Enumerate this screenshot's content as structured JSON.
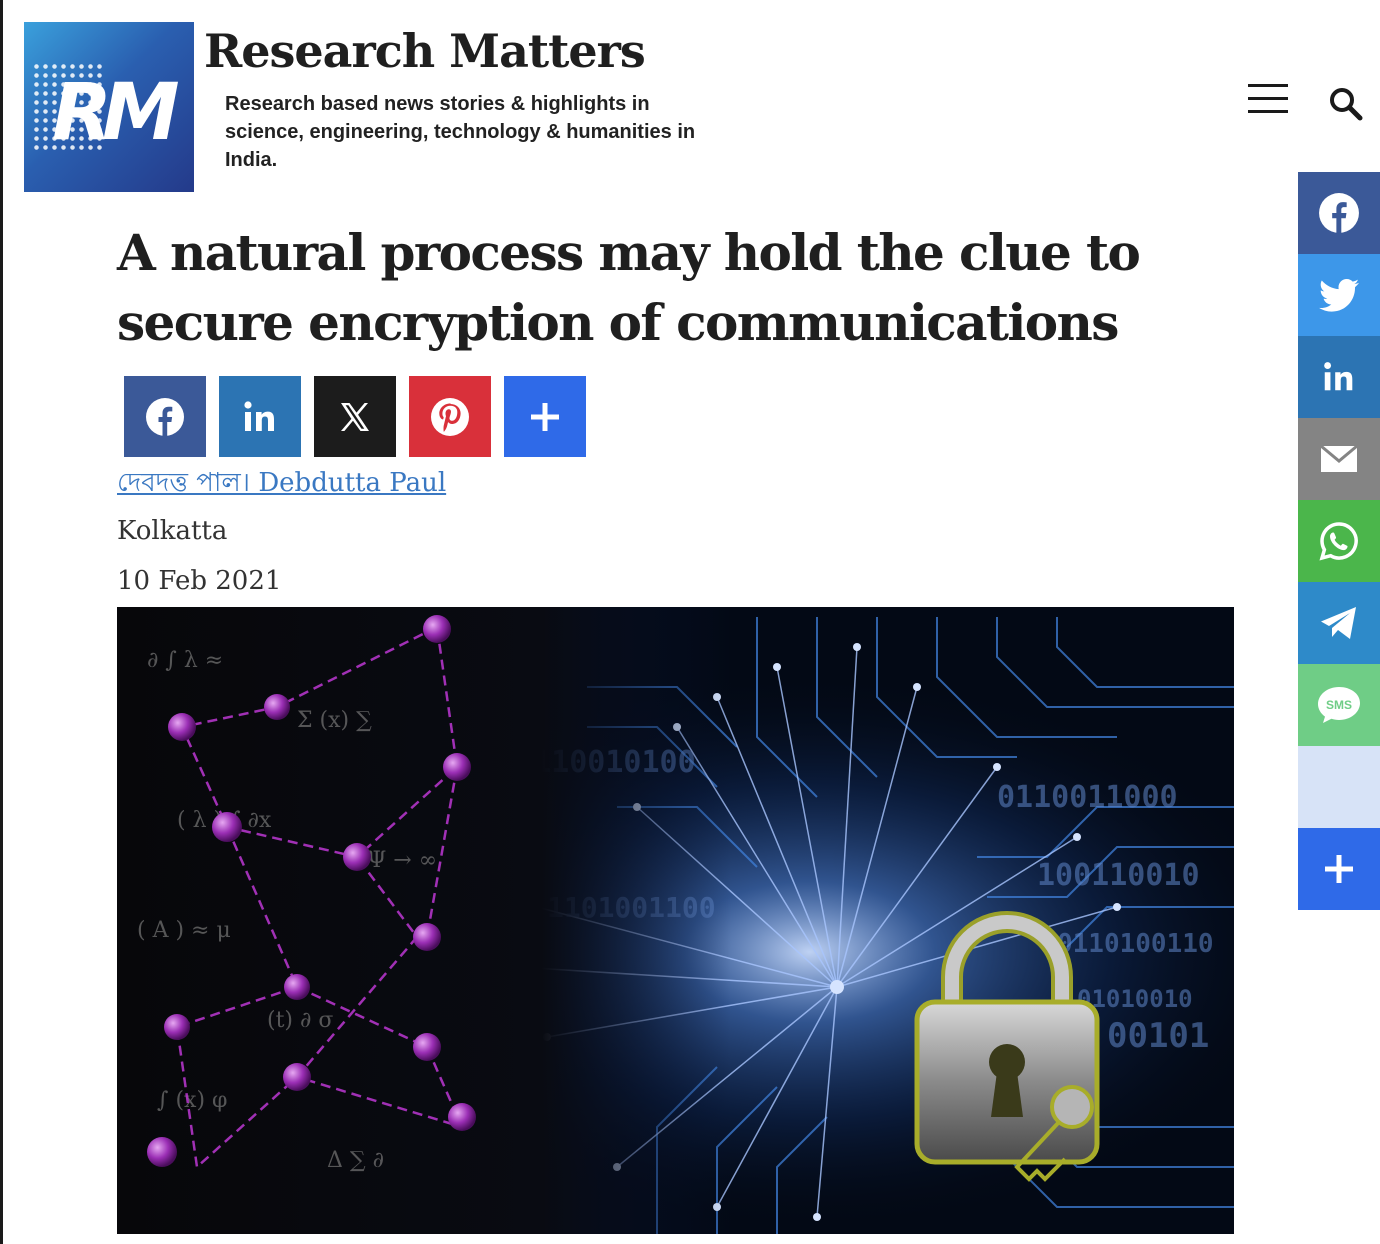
{
  "header": {
    "logo_text": "RM",
    "site_title": "Research Matters",
    "tagline": "Research based news stories & highlights in science, engineering, technology & humanities in India.",
    "menu_icon": "hamburger-menu-icon",
    "search_icon": "search-icon"
  },
  "article": {
    "headline": "A natural process may hold the clue to secure encryption of communications",
    "share_buttons": [
      {
        "network": "Facebook",
        "icon": "facebook-icon",
        "color": "#3b5998"
      },
      {
        "network": "LinkedIn",
        "icon": "linkedin-icon",
        "color": "#2c74b3"
      },
      {
        "network": "X",
        "icon": "x-icon",
        "color": "#1c1c1c"
      },
      {
        "network": "Pinterest",
        "icon": "pinterest-icon",
        "color": "#d9303a"
      },
      {
        "network": "More",
        "icon": "plus-icon",
        "color": "#2f6ae8"
      }
    ],
    "author": "দেবদত্ত পাল। Debdutta Paul",
    "location": "Kolkatta",
    "date": "10 Feb 2021",
    "hero_binary": [
      "10110010100",
      "0110011000",
      "100110010",
      "1101001100",
      "0110100110",
      "01010010",
      "00101"
    ]
  },
  "floating_share": [
    {
      "network": "Facebook",
      "icon": "facebook-icon",
      "color": "#3b5998"
    },
    {
      "network": "Twitter",
      "icon": "twitter-icon",
      "color": "#3d97e9"
    },
    {
      "network": "LinkedIn",
      "icon": "linkedin-icon",
      "color": "#2c74b3"
    },
    {
      "network": "Email",
      "icon": "email-icon",
      "color": "#848484"
    },
    {
      "network": "WhatsApp",
      "icon": "whatsapp-icon",
      "color": "#4bb64b"
    },
    {
      "network": "Telegram",
      "icon": "telegram-icon",
      "color": "#2e8ac9"
    },
    {
      "network": "SMS",
      "icon": "sms-icon",
      "label": "SMS",
      "color": "#6fcd86"
    },
    {
      "network": "",
      "icon": "",
      "color": "#d7e3f7"
    },
    {
      "network": "More",
      "icon": "plus-icon",
      "color": "#2f6ae8"
    }
  ]
}
